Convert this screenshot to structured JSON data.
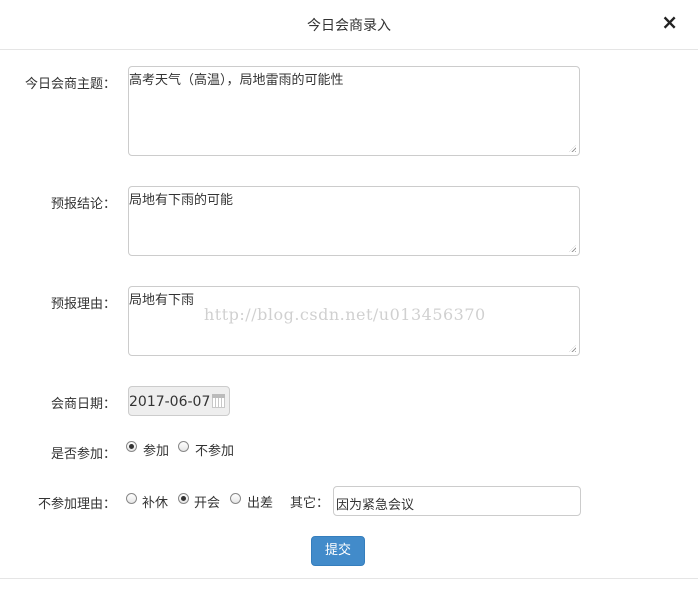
{
  "dialog": {
    "title": "今日会商录入",
    "close_icon": "×"
  },
  "form": {
    "topic": {
      "label": "今日会商主题：",
      "value": "高考天气（高温），局地雷雨的可能性"
    },
    "conclusion": {
      "label": "预报结论：",
      "value": "局地有下雨的可能"
    },
    "reason": {
      "label": "预报理由：",
      "value": "局地有下雨"
    },
    "date": {
      "label": "会商日期：",
      "value": "2017-06-07",
      "icon": "calendar-icon"
    },
    "attend": {
      "label": "是否参加：",
      "options": [
        {
          "label": "参加",
          "selected": true
        },
        {
          "label": "不参加",
          "selected": false
        }
      ]
    },
    "absence_reason": {
      "label": "不参加理由：",
      "options": [
        {
          "label": "补休",
          "selected": false
        },
        {
          "label": "开会",
          "selected": true
        },
        {
          "label": "出差",
          "selected": false
        }
      ],
      "other_label": "其它：",
      "other_value": "因为紧急会议"
    },
    "submit_label": "提交"
  },
  "watermark": "http://blog.csdn.net/u013456370",
  "colors": {
    "primary": "#428bca",
    "border": "#cccccc",
    "readonly_bg": "#eeeeee"
  }
}
